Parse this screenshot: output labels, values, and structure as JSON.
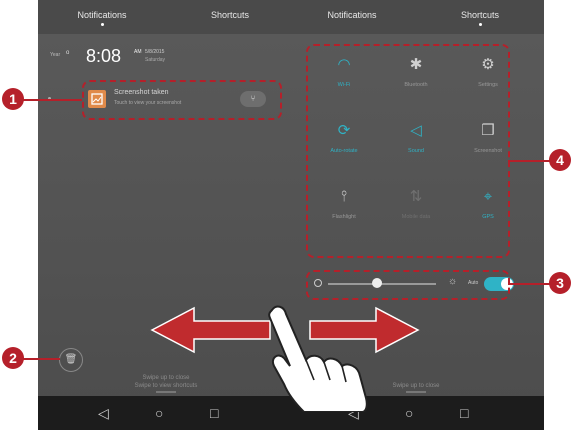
{
  "left_phone": {
    "tabs": [
      "Notifications",
      "Shortcuts"
    ],
    "active_tab": 0,
    "year_label": "Year",
    "time": "8:08",
    "ampm": "AM",
    "date": "5/8/2015",
    "weekday": "Saturday",
    "notification": {
      "title": "Screenshot taken",
      "subtitle": "Touch to view your screenshot"
    },
    "swipe_hint": [
      "Swipe up to close",
      "Swipe to view shortcuts"
    ]
  },
  "right_phone": {
    "tabs": [
      "Notifications",
      "Shortcuts"
    ],
    "active_tab": 1,
    "toggles": [
      {
        "label": "Wi-Fi",
        "icon": "wifi-icon",
        "state": "on"
      },
      {
        "label": "Bluetooth",
        "icon": "bluetooth-icon",
        "state": "off"
      },
      {
        "label": "Settings",
        "icon": "gear-icon",
        "state": "off"
      },
      {
        "label": "Auto-rotate",
        "icon": "rotate-icon",
        "state": "on"
      },
      {
        "label": "Sound",
        "icon": "speaker-icon",
        "state": "on"
      },
      {
        "label": "Screenshot",
        "icon": "screenshot-icon",
        "state": "off"
      },
      {
        "label": "Flashlight",
        "icon": "flashlight-icon",
        "state": "off"
      },
      {
        "label": "Mobile data",
        "icon": "mobile-data-icon",
        "state": "dim"
      },
      {
        "label": "GPS",
        "icon": "location-icon",
        "state": "on"
      }
    ],
    "brightness": {
      "level": 0.45,
      "auto_label": "Auto",
      "auto": true
    },
    "swipe_hint": "Swipe up to close"
  },
  "callouts": [
    "1",
    "2",
    "3",
    "4"
  ],
  "colors": {
    "accent": "#2fb3c6",
    "annotation": "#b5202a",
    "notif_icon": "#e08a4a"
  }
}
